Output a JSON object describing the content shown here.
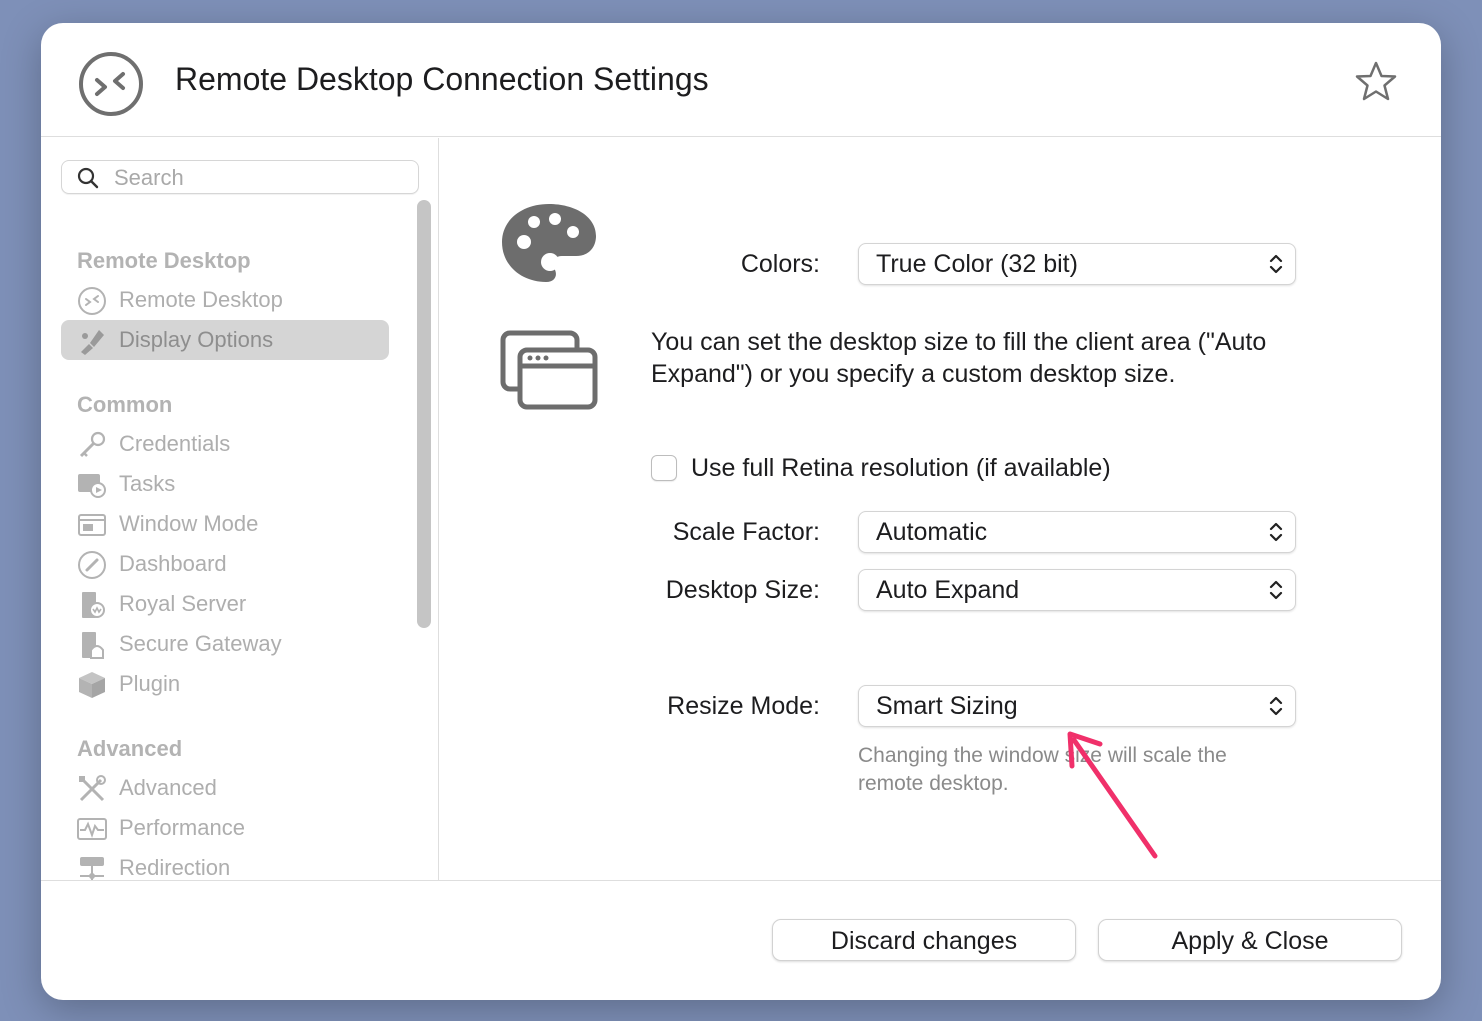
{
  "window": {
    "title": "Remote Desktop Connection Settings"
  },
  "sidebar": {
    "search_placeholder": "Search",
    "groups": [
      {
        "header": "Remote Desktop",
        "items": [
          {
            "label": "Remote Desktop",
            "icon": "remote-desktop-icon"
          },
          {
            "label": "Display Options",
            "icon": "display-options-icon",
            "selected": true
          }
        ]
      },
      {
        "header": "Common",
        "items": [
          {
            "label": "Credentials",
            "icon": "key-icon"
          },
          {
            "label": "Tasks",
            "icon": "tasks-icon"
          },
          {
            "label": "Window Mode",
            "icon": "window-icon"
          },
          {
            "label": "Dashboard",
            "icon": "dashboard-icon"
          },
          {
            "label": "Royal Server",
            "icon": "royal-server-icon"
          },
          {
            "label": "Secure Gateway",
            "icon": "secure-gateway-icon"
          },
          {
            "label": "Plugin",
            "icon": "plugin-icon"
          }
        ]
      },
      {
        "header": "Advanced",
        "items": [
          {
            "label": "Advanced",
            "icon": "tools-icon"
          },
          {
            "label": "Performance",
            "icon": "performance-icon"
          },
          {
            "label": "Redirection",
            "icon": "redirection-icon"
          }
        ]
      }
    ]
  },
  "content": {
    "colors": {
      "label": "Colors:",
      "value": "True Color (32 bit)"
    },
    "description": "You can set the desktop size to fill the client area (\"Auto Expand\") or you specify a custom desktop size.",
    "retina_checkbox": {
      "label": "Use full Retina resolution (if available)",
      "checked": false
    },
    "scale_factor": {
      "label": "Scale Factor:",
      "value": "Automatic"
    },
    "desktop_size": {
      "label": "Desktop Size:",
      "value": "Auto Expand"
    },
    "resize_mode": {
      "label": "Resize Mode:",
      "value": "Smart Sizing",
      "hint": "Changing the window size will scale the remote desktop."
    },
    "annotation_color": "#f0306a"
  },
  "footer": {
    "discard_label": "Discard changes",
    "apply_label": "Apply & Close"
  }
}
